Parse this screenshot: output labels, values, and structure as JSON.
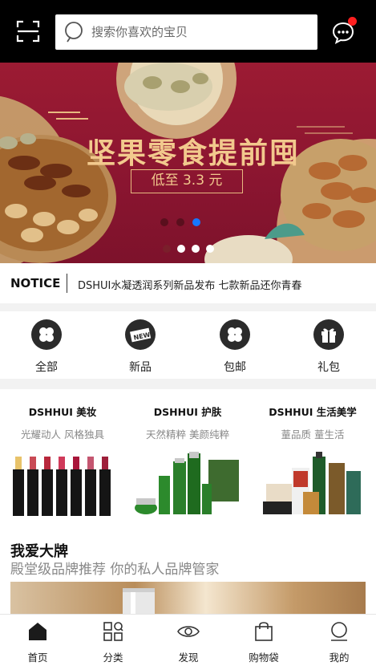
{
  "header": {
    "search_placeholder": "搜索你喜欢的宝贝",
    "scan_icon": "scan-icon",
    "message_icon": "chat-bubble-icon"
  },
  "banner": {
    "title": "坚果零食提前囤",
    "subtitle": "低至 3.3 元",
    "active_slide": 3,
    "slide_count": 5
  },
  "notice": {
    "label": "NOTICE",
    "text": "DSHUI水凝透润系列新品发布 七款新品还你青春"
  },
  "categories": [
    {
      "label": "全部",
      "icon": "clover-icon"
    },
    {
      "label": "新品",
      "icon": "new-tag-icon"
    },
    {
      "label": "包邮",
      "icon": "clover-icon"
    },
    {
      "label": "礼包",
      "icon": "gift-icon"
    }
  ],
  "promos": [
    {
      "title": "DSHHUI 美妆",
      "subtitle": "光耀动人 风格独具"
    },
    {
      "title": "DSHHUI 护肤",
      "subtitle": "天然精粹 美颜纯粹"
    },
    {
      "title": "DSHHUI 生活美学",
      "subtitle": "蕫品质 蕫生活"
    }
  ],
  "brand": {
    "title": "我爱大牌",
    "subtitle": "殿堂级品牌推荐 你的私人品牌管家"
  },
  "tabs": [
    {
      "label": "首页",
      "icon": "home-icon"
    },
    {
      "label": "分类",
      "icon": "category-icon"
    },
    {
      "label": "发现",
      "icon": "eye-icon"
    },
    {
      "label": "购物袋",
      "icon": "shopping-bag-icon"
    },
    {
      "label": "我的",
      "icon": "user-icon"
    }
  ],
  "colors": {
    "header_bg": "#000000",
    "banner_bg": "#8a1530",
    "banner_text": "#f2c98d",
    "badge_red": "#ff1f1f",
    "active_dot": "#1677ff"
  }
}
